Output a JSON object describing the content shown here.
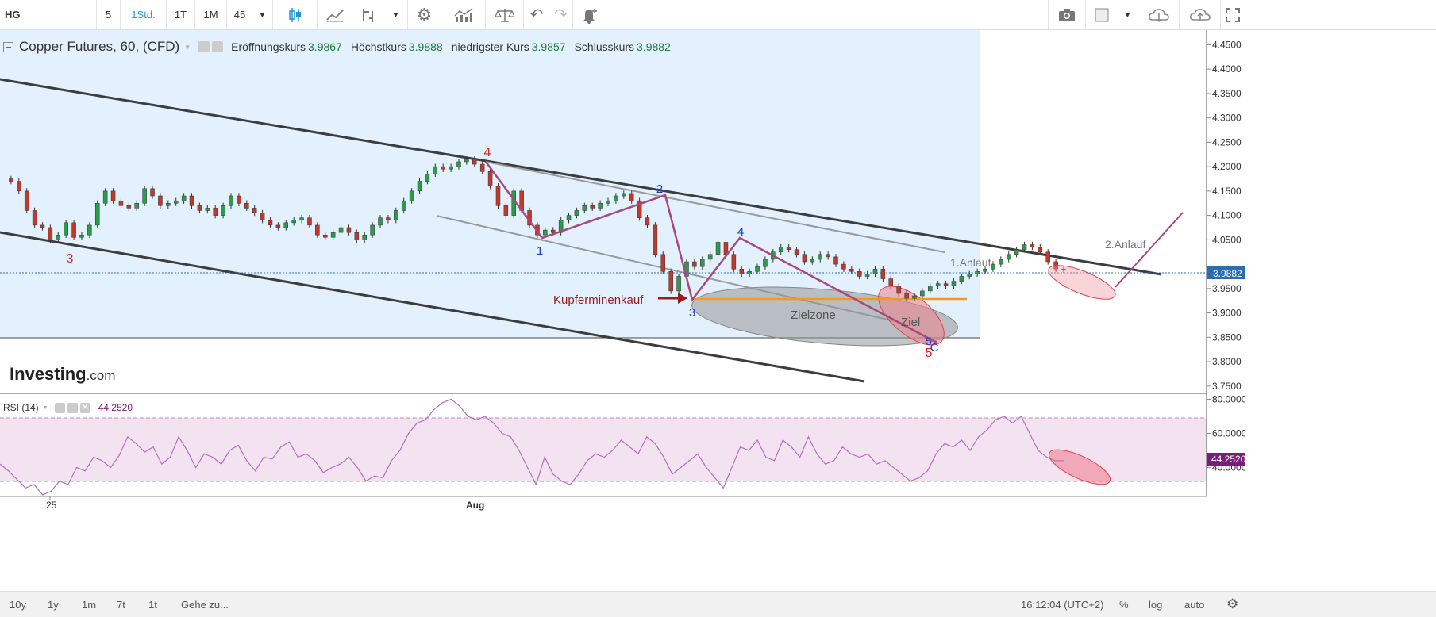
{
  "toolbar": {
    "symbol": "HG",
    "intervals": [
      "5",
      "1Std.",
      "1T",
      "1M",
      "45"
    ],
    "active_interval": "1Std."
  },
  "legend": {
    "title": "Copper Futures, 60, (CFD)",
    "open_label": "Eröffnungskurs",
    "open_value": "3.9867",
    "high_label": "Höchstkurs",
    "high_value": "3.9888",
    "low_label": "niedrigster Kurs",
    "low_value": "3.9857",
    "close_label": "Schlusskurs",
    "close_value": "3.9882"
  },
  "watermark": {
    "brand": "Investing",
    "suffix": ".com"
  },
  "rsi": {
    "label": "RSI (14)",
    "value": "44.2520",
    "current_tag": "44.2520"
  },
  "annotations": {
    "kupfer": "Kupferminenkauf",
    "zielzone": "Zielzone",
    "ziel": "Ziel",
    "anlauf1": "1.Anlauf",
    "anlauf2": "2.Anlauf",
    "wave_labels": [
      "3",
      "4",
      "1",
      "2",
      "3",
      "4",
      "5",
      "C",
      "5"
    ]
  },
  "bottombar": {
    "ranges": [
      "10y",
      "1y",
      "1m",
      "7t",
      "1t"
    ],
    "goto": "Gehe zu...",
    "time": "16:12:04 (UTC+2)",
    "percent": "%",
    "log": "log",
    "auto": "auto"
  },
  "chart_data": [
    {
      "type": "candlestick",
      "title": "Copper Futures, 60, (CFD)",
      "y_ticks": [
        "4.4500",
        "4.4000",
        "4.3500",
        "4.3000",
        "4.2500",
        "4.2000",
        "4.1500",
        "4.1000",
        "4.0500",
        "3.9500",
        "3.9000",
        "3.8500",
        "3.8000",
        "3.7500"
      ],
      "ylim": [
        3.735,
        4.48
      ],
      "current_price": "3.9882",
      "x_ticks": [
        "25",
        "Aug"
      ],
      "ohlc_path": [
        4.175,
        4.17,
        4.15,
        4.11,
        4.08,
        4.075,
        4.05,
        4.06,
        4.085,
        4.055,
        4.06,
        4.08,
        4.125,
        4.15,
        4.13,
        4.12,
        4.115,
        4.125,
        4.155,
        4.14,
        4.12,
        4.125,
        4.13,
        4.14,
        4.12,
        4.11,
        4.115,
        4.1,
        4.12,
        4.14,
        4.125,
        4.115,
        4.105,
        4.09,
        4.08,
        4.075,
        4.085,
        4.09,
        4.095,
        4.08,
        4.06,
        4.055,
        4.065,
        4.075,
        4.065,
        4.05,
        4.06,
        4.08,
        4.095,
        4.09,
        4.11,
        4.13,
        4.15,
        4.17,
        4.185,
        4.2,
        4.195,
        4.2,
        4.21,
        4.215,
        4.205,
        4.19,
        4.16,
        4.12,
        4.1,
        4.15,
        4.11,
        4.08,
        4.06,
        4.07,
        4.065,
        4.09,
        4.1,
        4.11,
        4.12,
        4.115,
        4.125,
        4.13,
        4.14,
        4.145,
        4.13,
        4.095,
        4.08,
        4.02,
        3.985,
        3.945,
        3.975,
        4.005,
        3.995,
        4.01,
        4.02,
        4.045,
        4.02,
        3.99,
        3.98,
        3.985,
        3.995,
        4.01,
        4.025,
        4.035,
        4.03,
        4.02,
        4.005,
        4.01,
        4.02,
        4.015,
        4.0,
        3.99,
        3.985,
        3.975,
        3.98,
        3.99,
        3.97,
        3.955,
        3.94,
        3.93,
        3.935,
        3.945,
        3.955,
        3.96,
        3.955,
        3.965,
        3.975,
        3.98,
        3.985,
        3.99,
        4.0,
        4.01,
        4.02,
        4.03,
        4.04,
        4.035,
        4.025,
        4.005,
        3.99,
        3.988
      ]
    },
    {
      "type": "line",
      "title": "RSI (14)",
      "y_ticks": [
        "80.0000",
        "60.0000",
        "40.0000"
      ],
      "ylim": [
        23,
        83
      ],
      "levels": [
        70,
        30
      ],
      "current_value": 44.252,
      "values": [
        42,
        38,
        33,
        28,
        30,
        24,
        26,
        32,
        30,
        40,
        38,
        46,
        44,
        40,
        47,
        58,
        54,
        49,
        52,
        42,
        46,
        58,
        50,
        40,
        48,
        46,
        42,
        50,
        53,
        44,
        38,
        46,
        45,
        52,
        55,
        46,
        48,
        44,
        37,
        40,
        42,
        46,
        40,
        32,
        35,
        34,
        44,
        50,
        60,
        66,
        68,
        74,
        78,
        80,
        76,
        70,
        68,
        70,
        66,
        60,
        58,
        50,
        40,
        30,
        46,
        36,
        32,
        30,
        36,
        44,
        48,
        46,
        50,
        56,
        52,
        48,
        58,
        54,
        46,
        36,
        40,
        44,
        48,
        40,
        34,
        28,
        40,
        52,
        50,
        56,
        46,
        44,
        56,
        52,
        46,
        58,
        48,
        42,
        44,
        52,
        48,
        46,
        48,
        42,
        44,
        40,
        36,
        32,
        34,
        38,
        48,
        54,
        52,
        56,
        50,
        58,
        62,
        68,
        70,
        66,
        70,
        60,
        50,
        46,
        44,
        44
      ]
    }
  ]
}
